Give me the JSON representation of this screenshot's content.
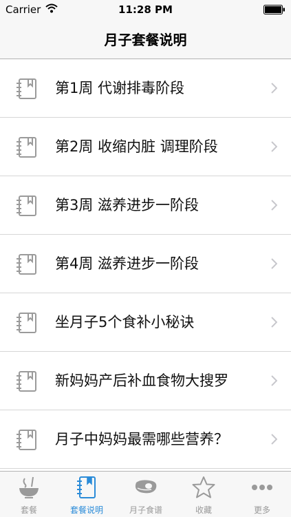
{
  "status_bar": {
    "carrier": "Carrier",
    "time": "11:28 PM"
  },
  "nav": {
    "title": "月子套餐说明"
  },
  "list": {
    "items": [
      {
        "label": "第1周 代谢排毒阶段",
        "icon": "book-icon"
      },
      {
        "label": "第2周 收缩内脏 调理阶段",
        "icon": "book-icon"
      },
      {
        "label": "第3周 滋养进步一阶段",
        "icon": "book-icon"
      },
      {
        "label": "第4周 滋养进步一阶段",
        "icon": "book-icon"
      },
      {
        "label": "坐月子5个食补小秘诀",
        "icon": "book-icon"
      },
      {
        "label": "新妈妈产后补血食物大搜罗",
        "icon": "book-icon"
      },
      {
        "label": "月子中妈妈最需哪些营养？",
        "icon": "book-icon"
      }
    ]
  },
  "tab_bar": {
    "active_color": "#2a8bd8",
    "inactive_color": "#9a9a9a",
    "tabs": [
      {
        "label": "套餐",
        "icon": "bowl-icon",
        "active": false
      },
      {
        "label": "套餐说明",
        "icon": "book-icon",
        "active": true
      },
      {
        "label": "月子食谱",
        "icon": "meat-icon",
        "active": false
      },
      {
        "label": "收藏",
        "icon": "star-icon",
        "active": false
      },
      {
        "label": "更多",
        "icon": "more-icon",
        "active": false
      }
    ]
  }
}
